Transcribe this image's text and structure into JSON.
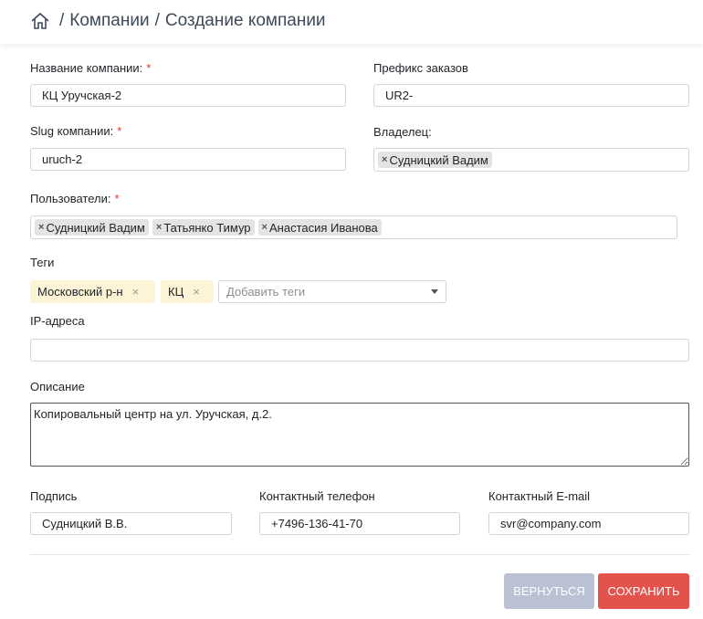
{
  "breadcrumb": {
    "home_icon": "home-icon",
    "separator": "/",
    "items": [
      "Компании",
      "Создание компании"
    ]
  },
  "form": {
    "company_name": {
      "label": "Название компании:",
      "required": "*",
      "value": "КЦ Уручская-2"
    },
    "order_prefix": {
      "label": "Префикс заказов",
      "value": "UR2-"
    },
    "slug": {
      "label": "Slug компании:",
      "required": "*",
      "value": "uruch-2"
    },
    "owner": {
      "label": "Владелец:",
      "chips": [
        "Судницкий Вадим"
      ]
    },
    "users": {
      "label": "Пользователи:",
      "required": "*",
      "chips": [
        "Судницкий Вадим",
        "Татьянко Тимур",
        "Анастасия Иванова"
      ]
    },
    "tags": {
      "label": "Теги",
      "items": [
        "Московский р-н",
        "КЦ"
      ],
      "remove_glyph": "×",
      "placeholder": "Добавить теги"
    },
    "ip": {
      "label": "IP-адреса",
      "value": ""
    },
    "description": {
      "label": "Описание",
      "value": "Копировальный центр на ул. Уручская, д.2."
    },
    "signature": {
      "label": "Подпись",
      "value": "Судницкий В.В."
    },
    "phone": {
      "label": "Контактный телефон",
      "value": "+7496-136-41-70"
    },
    "email": {
      "label": "Контактный E-mail",
      "value": "svr@company.com"
    },
    "chip_remove": "×"
  },
  "buttons": {
    "back": "Вернуться",
    "save": "Сохранить"
  },
  "colors": {
    "required": "#e3342f",
    "tag_bg": "#fdf3d6",
    "save": "#e3534c",
    "back": "#b9c1d3"
  }
}
